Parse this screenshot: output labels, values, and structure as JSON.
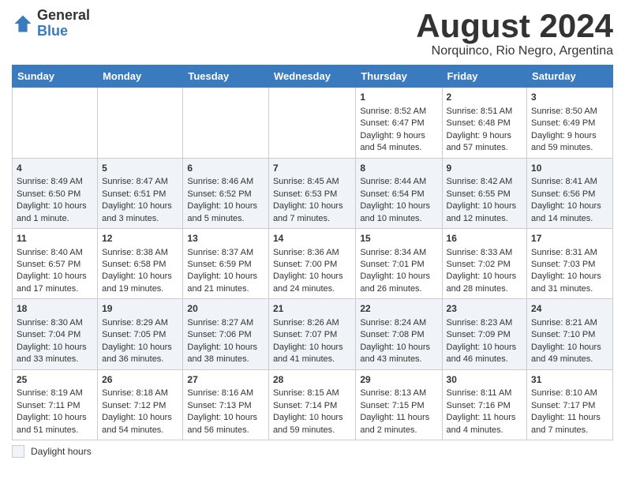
{
  "header": {
    "logo_general": "General",
    "logo_blue": "Blue",
    "month_title": "August 2024",
    "subtitle": "Norquinco, Rio Negro, Argentina"
  },
  "weekdays": [
    "Sunday",
    "Monday",
    "Tuesday",
    "Wednesday",
    "Thursday",
    "Friday",
    "Saturday"
  ],
  "weeks": [
    [
      {
        "day": "",
        "content": ""
      },
      {
        "day": "",
        "content": ""
      },
      {
        "day": "",
        "content": ""
      },
      {
        "day": "",
        "content": ""
      },
      {
        "day": "1",
        "content": "Sunrise: 8:52 AM\nSunset: 6:47 PM\nDaylight: 9 hours and 54 minutes."
      },
      {
        "day": "2",
        "content": "Sunrise: 8:51 AM\nSunset: 6:48 PM\nDaylight: 9 hours and 57 minutes."
      },
      {
        "day": "3",
        "content": "Sunrise: 8:50 AM\nSunset: 6:49 PM\nDaylight: 9 hours and 59 minutes."
      }
    ],
    [
      {
        "day": "4",
        "content": "Sunrise: 8:49 AM\nSunset: 6:50 PM\nDaylight: 10 hours and 1 minute."
      },
      {
        "day": "5",
        "content": "Sunrise: 8:47 AM\nSunset: 6:51 PM\nDaylight: 10 hours and 3 minutes."
      },
      {
        "day": "6",
        "content": "Sunrise: 8:46 AM\nSunset: 6:52 PM\nDaylight: 10 hours and 5 minutes."
      },
      {
        "day": "7",
        "content": "Sunrise: 8:45 AM\nSunset: 6:53 PM\nDaylight: 10 hours and 7 minutes."
      },
      {
        "day": "8",
        "content": "Sunrise: 8:44 AM\nSunset: 6:54 PM\nDaylight: 10 hours and 10 minutes."
      },
      {
        "day": "9",
        "content": "Sunrise: 8:42 AM\nSunset: 6:55 PM\nDaylight: 10 hours and 12 minutes."
      },
      {
        "day": "10",
        "content": "Sunrise: 8:41 AM\nSunset: 6:56 PM\nDaylight: 10 hours and 14 minutes."
      }
    ],
    [
      {
        "day": "11",
        "content": "Sunrise: 8:40 AM\nSunset: 6:57 PM\nDaylight: 10 hours and 17 minutes."
      },
      {
        "day": "12",
        "content": "Sunrise: 8:38 AM\nSunset: 6:58 PM\nDaylight: 10 hours and 19 minutes."
      },
      {
        "day": "13",
        "content": "Sunrise: 8:37 AM\nSunset: 6:59 PM\nDaylight: 10 hours and 21 minutes."
      },
      {
        "day": "14",
        "content": "Sunrise: 8:36 AM\nSunset: 7:00 PM\nDaylight: 10 hours and 24 minutes."
      },
      {
        "day": "15",
        "content": "Sunrise: 8:34 AM\nSunset: 7:01 PM\nDaylight: 10 hours and 26 minutes."
      },
      {
        "day": "16",
        "content": "Sunrise: 8:33 AM\nSunset: 7:02 PM\nDaylight: 10 hours and 28 minutes."
      },
      {
        "day": "17",
        "content": "Sunrise: 8:31 AM\nSunset: 7:03 PM\nDaylight: 10 hours and 31 minutes."
      }
    ],
    [
      {
        "day": "18",
        "content": "Sunrise: 8:30 AM\nSunset: 7:04 PM\nDaylight: 10 hours and 33 minutes."
      },
      {
        "day": "19",
        "content": "Sunrise: 8:29 AM\nSunset: 7:05 PM\nDaylight: 10 hours and 36 minutes."
      },
      {
        "day": "20",
        "content": "Sunrise: 8:27 AM\nSunset: 7:06 PM\nDaylight: 10 hours and 38 minutes."
      },
      {
        "day": "21",
        "content": "Sunrise: 8:26 AM\nSunset: 7:07 PM\nDaylight: 10 hours and 41 minutes."
      },
      {
        "day": "22",
        "content": "Sunrise: 8:24 AM\nSunset: 7:08 PM\nDaylight: 10 hours and 43 minutes."
      },
      {
        "day": "23",
        "content": "Sunrise: 8:23 AM\nSunset: 7:09 PM\nDaylight: 10 hours and 46 minutes."
      },
      {
        "day": "24",
        "content": "Sunrise: 8:21 AM\nSunset: 7:10 PM\nDaylight: 10 hours and 49 minutes."
      }
    ],
    [
      {
        "day": "25",
        "content": "Sunrise: 8:19 AM\nSunset: 7:11 PM\nDaylight: 10 hours and 51 minutes."
      },
      {
        "day": "26",
        "content": "Sunrise: 8:18 AM\nSunset: 7:12 PM\nDaylight: 10 hours and 54 minutes."
      },
      {
        "day": "27",
        "content": "Sunrise: 8:16 AM\nSunset: 7:13 PM\nDaylight: 10 hours and 56 minutes."
      },
      {
        "day": "28",
        "content": "Sunrise: 8:15 AM\nSunset: 7:14 PM\nDaylight: 10 hours and 59 minutes."
      },
      {
        "day": "29",
        "content": "Sunrise: 8:13 AM\nSunset: 7:15 PM\nDaylight: 11 hours and 2 minutes."
      },
      {
        "day": "30",
        "content": "Sunrise: 8:11 AM\nSunset: 7:16 PM\nDaylight: 11 hours and 4 minutes."
      },
      {
        "day": "31",
        "content": "Sunrise: 8:10 AM\nSunset: 7:17 PM\nDaylight: 11 hours and 7 minutes."
      }
    ]
  ],
  "footer": {
    "label": "Daylight hours"
  }
}
